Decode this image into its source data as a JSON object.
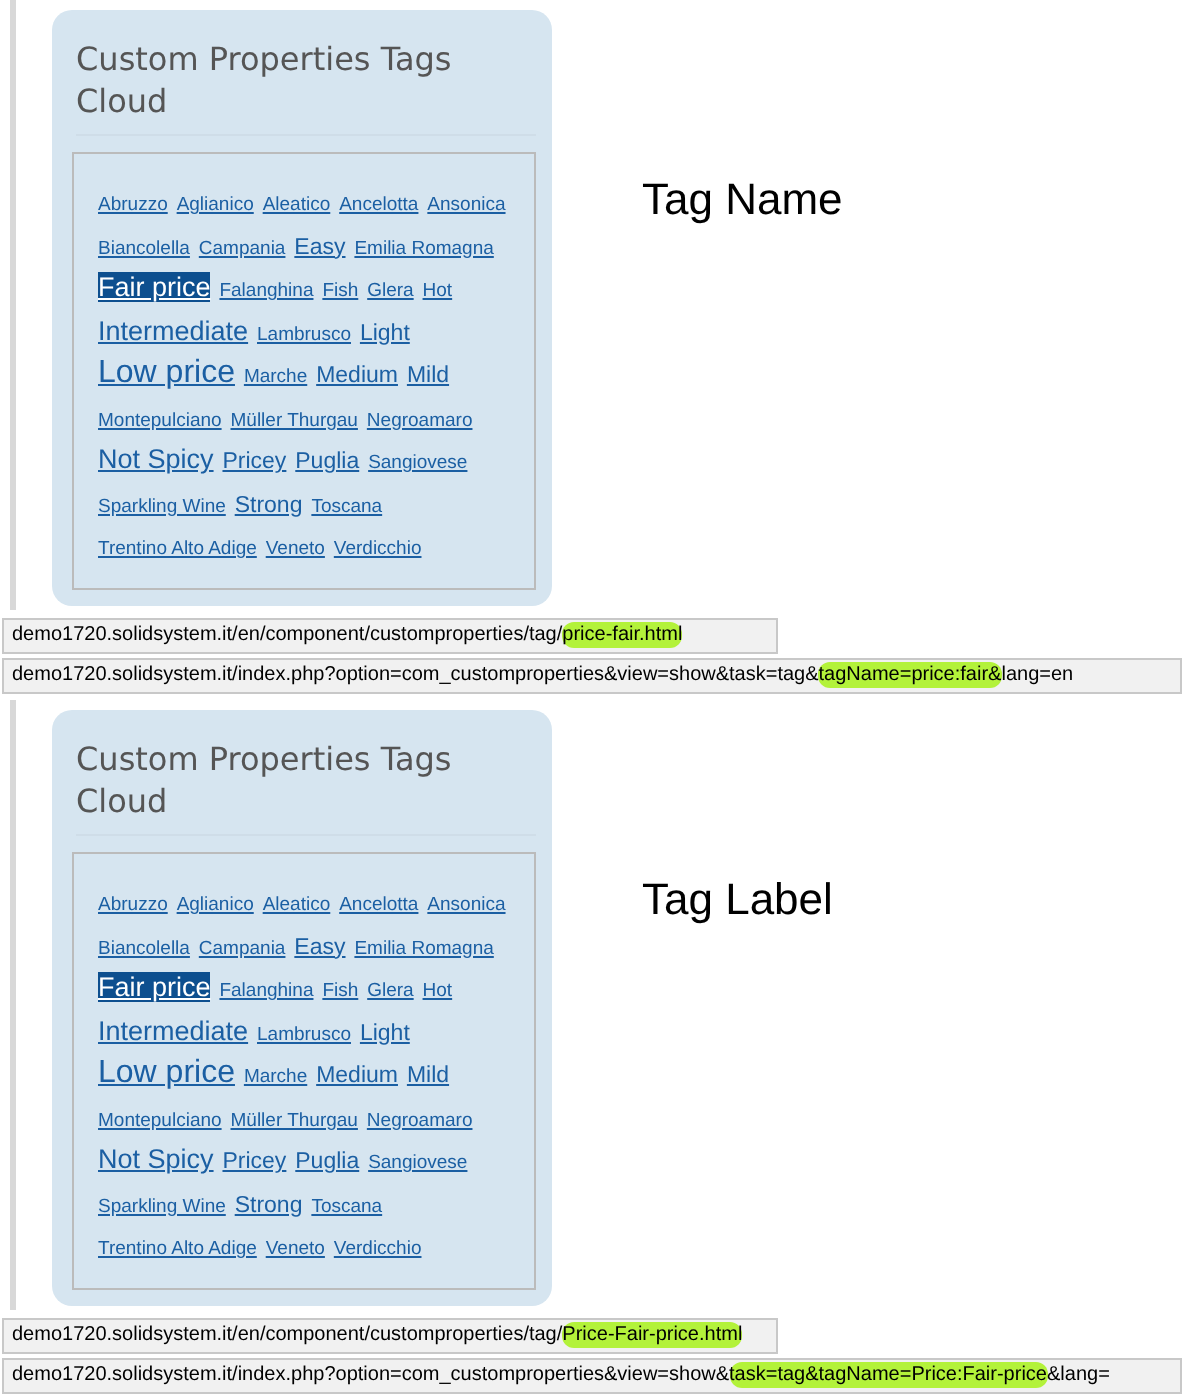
{
  "examples": [
    {
      "widget": {
        "title": "Custom Properties Tags Cloud",
        "tags": [
          {
            "label": "Abruzzo",
            "kind": "small",
            "selected": false
          },
          {
            "label": "Aglianico",
            "kind": "small",
            "selected": false
          },
          {
            "label": "Aleatico",
            "kind": "small",
            "selected": false
          },
          {
            "label": "Ancelotta",
            "kind": "small",
            "selected": false
          },
          {
            "label": "Ansonica",
            "kind": "small",
            "selected": false
          },
          {
            "label": "Biancolella",
            "kind": "small",
            "selected": false
          },
          {
            "label": "Campania",
            "kind": "small",
            "selected": false
          },
          {
            "label": "Easy",
            "kind": "medium",
            "selected": false
          },
          {
            "label": "Emilia Romagna",
            "kind": "small",
            "selected": false
          },
          {
            "label": "Fair price",
            "kind": "large",
            "selected": true
          },
          {
            "label": "Falanghina",
            "kind": "small",
            "selected": false
          },
          {
            "label": "Fish",
            "kind": "small",
            "selected": false
          },
          {
            "label": "Glera",
            "kind": "small",
            "selected": false
          },
          {
            "label": "Hot",
            "kind": "small",
            "selected": false
          },
          {
            "label": "Intermediate",
            "kind": "large",
            "selected": false
          },
          {
            "label": "Lambrusco",
            "kind": "small",
            "selected": false
          },
          {
            "label": "Light",
            "kind": "medium",
            "selected": false
          },
          {
            "label": "Low price",
            "kind": "huge",
            "selected": false
          },
          {
            "label": "Marche",
            "kind": "small",
            "selected": false
          },
          {
            "label": "Medium",
            "kind": "medium",
            "selected": false
          },
          {
            "label": "Mild",
            "kind": "medium",
            "selected": false
          },
          {
            "label": "Montepulciano",
            "kind": "small",
            "selected": false
          },
          {
            "label": "Müller Thurgau",
            "kind": "small",
            "selected": false
          },
          {
            "label": "Negroamaro",
            "kind": "small",
            "selected": false
          },
          {
            "label": "Not Spicy",
            "kind": "large",
            "selected": false
          },
          {
            "label": "Pricey",
            "kind": "medium",
            "selected": false
          },
          {
            "label": "Puglia",
            "kind": "medium",
            "selected": false
          },
          {
            "label": "Sangiovese",
            "kind": "small",
            "selected": false
          },
          {
            "label": "Sparkling Wine",
            "kind": "small",
            "selected": false
          },
          {
            "label": "Strong",
            "kind": "medium",
            "selected": false
          },
          {
            "label": "Toscana",
            "kind": "small",
            "selected": false
          },
          {
            "label": "Trentino Alto Adige",
            "kind": "small",
            "selected": false
          },
          {
            "label": "Veneto",
            "kind": "small",
            "selected": false
          },
          {
            "label": "Verdicchio",
            "kind": "small",
            "selected": false
          }
        ]
      },
      "caption": "Tag Name",
      "status_links": [
        {
          "segments": [
            {
              "text": "demo1720.solidsystem.it/en/component/customproperties/tag/",
              "highlighted": false
            },
            {
              "text": "price-fair.html",
              "highlighted": true
            }
          ]
        },
        {
          "segments": [
            {
              "text": "demo1720.solidsystem.it/index.php?option=com_customproperties&view=show&task=tag&",
              "highlighted": false
            },
            {
              "text": "tagName=price:fair&",
              "highlighted": true
            },
            {
              "text": "lang=en",
              "highlighted": false
            }
          ]
        }
      ]
    },
    {
      "widget": {
        "title": "Custom Properties Tags Cloud",
        "tags": [
          {
            "label": "Abruzzo",
            "kind": "small",
            "selected": false
          },
          {
            "label": "Aglianico",
            "kind": "small",
            "selected": false
          },
          {
            "label": "Aleatico",
            "kind": "small",
            "selected": false
          },
          {
            "label": "Ancelotta",
            "kind": "small",
            "selected": false
          },
          {
            "label": "Ansonica",
            "kind": "small",
            "selected": false
          },
          {
            "label": "Biancolella",
            "kind": "small",
            "selected": false
          },
          {
            "label": "Campania",
            "kind": "small",
            "selected": false
          },
          {
            "label": "Easy",
            "kind": "medium",
            "selected": false
          },
          {
            "label": "Emilia Romagna",
            "kind": "small",
            "selected": false
          },
          {
            "label": "Fair price",
            "kind": "large",
            "selected": true
          },
          {
            "label": "Falanghina",
            "kind": "small",
            "selected": false
          },
          {
            "label": "Fish",
            "kind": "small",
            "selected": false
          },
          {
            "label": "Glera",
            "kind": "small",
            "selected": false
          },
          {
            "label": "Hot",
            "kind": "small",
            "selected": false
          },
          {
            "label": "Intermediate",
            "kind": "large",
            "selected": false
          },
          {
            "label": "Lambrusco",
            "kind": "small",
            "selected": false
          },
          {
            "label": "Light",
            "kind": "medium",
            "selected": false
          },
          {
            "label": "Low price",
            "kind": "huge",
            "selected": false
          },
          {
            "label": "Marche",
            "kind": "small",
            "selected": false
          },
          {
            "label": "Medium",
            "kind": "medium",
            "selected": false
          },
          {
            "label": "Mild",
            "kind": "medium",
            "selected": false
          },
          {
            "label": "Montepulciano",
            "kind": "small",
            "selected": false
          },
          {
            "label": "Müller Thurgau",
            "kind": "small",
            "selected": false
          },
          {
            "label": "Negroamaro",
            "kind": "small",
            "selected": false
          },
          {
            "label": "Not Spicy",
            "kind": "large",
            "selected": false
          },
          {
            "label": "Pricey",
            "kind": "medium",
            "selected": false
          },
          {
            "label": "Puglia",
            "kind": "medium",
            "selected": false
          },
          {
            "label": "Sangiovese",
            "kind": "small",
            "selected": false
          },
          {
            "label": "Sparkling Wine",
            "kind": "small",
            "selected": false
          },
          {
            "label": "Strong",
            "kind": "medium",
            "selected": false
          },
          {
            "label": "Toscana",
            "kind": "small",
            "selected": false
          },
          {
            "label": "Trentino Alto Adige",
            "kind": "small",
            "selected": false
          },
          {
            "label": "Veneto",
            "kind": "small",
            "selected": false
          },
          {
            "label": "Verdicchio",
            "kind": "small",
            "selected": false
          }
        ]
      },
      "caption": "Tag Label",
      "status_links": [
        {
          "segments": [
            {
              "text": "demo1720.solidsystem.it/en/component/customproperties/tag/",
              "highlighted": false
            },
            {
              "text": "Price-Fair-price.html",
              "highlighted": true
            }
          ]
        },
        {
          "segments": [
            {
              "text": "demo1720.solidsystem.it/index.php?option=com_customproperties&view=show&",
              "highlighted": false
            },
            {
              "text": "task=tag&tagName=Price:Fair-price",
              "highlighted": true
            },
            {
              "text": "&lang=",
              "highlighted": false
            }
          ]
        }
      ]
    }
  ]
}
